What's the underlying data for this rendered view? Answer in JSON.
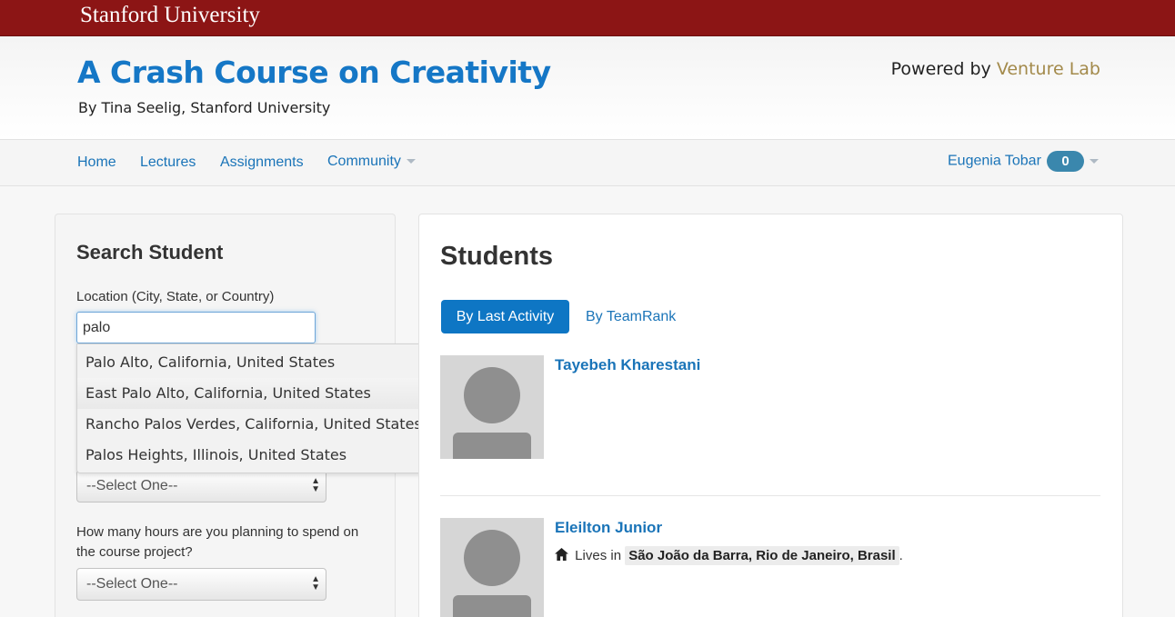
{
  "topbar": {
    "brand": "Stanford University"
  },
  "header": {
    "title": "A Crash Course on Creativity",
    "subtitle": "By Tina Seelig, Stanford University",
    "powered_prefix": "Powered by ",
    "powered_brand": "Venture Lab"
  },
  "nav": {
    "items": [
      "Home",
      "Lectures",
      "Assignments",
      "Community"
    ],
    "user": "Eugenia Tobar",
    "badge_count": "0"
  },
  "search": {
    "title": "Search Student",
    "location_label": "Location (City, State, or Country)",
    "location_value": "palo",
    "suggestions": [
      "Palo Alto, California, United States",
      "East Palo Alto, California, United States",
      "Rancho Palos Verdes, California, United States",
      "Palos Heights, Illinois, United States"
    ],
    "select_placeholder": "--Select One--",
    "hours_label": "How many hours are you planning to spend on the course project?"
  },
  "students": {
    "title": "Students",
    "tabs": [
      "By Last Activity",
      "By TeamRank"
    ],
    "list": [
      {
        "name": "Tayebeh Kharestani"
      },
      {
        "name": "Eleilton Junior",
        "lives_in": "Lives in",
        "location": "São João da Barra, Rio de Janeiro, Brasil",
        "trailing": "."
      }
    ]
  },
  "colors": {
    "stanford_red": "#8c1515",
    "link_blue": "#1a74b8",
    "title_blue": "#1577c6",
    "venture_gold": "#a38a4b",
    "badge_blue": "#3a87ad"
  }
}
